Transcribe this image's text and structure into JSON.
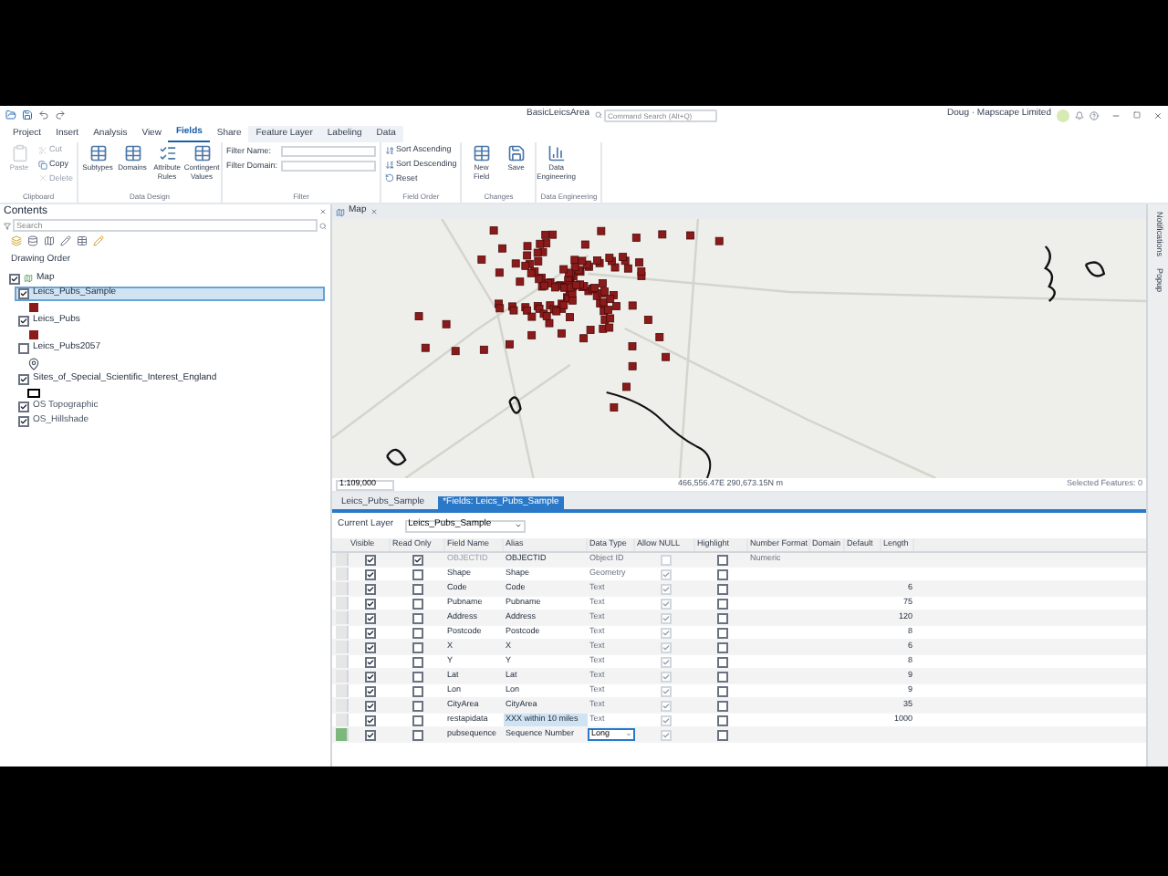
{
  "title_bar": {
    "project": "BasicLeicsArea",
    "search": {
      "placeholder": "Command Search (Alt+Q)"
    },
    "user": "Doug · Mapscape Limited"
  },
  "ribbon": {
    "tabs": [
      {
        "label": "Project",
        "selected": false,
        "contextual": false
      },
      {
        "label": "Insert",
        "selected": false,
        "contextual": false
      },
      {
        "label": "Analysis",
        "selected": false,
        "contextual": false
      },
      {
        "label": "View",
        "selected": false,
        "contextual": false
      },
      {
        "label": "Fields",
        "selected": true,
        "contextual": false
      },
      {
        "label": "Share",
        "selected": false,
        "contextual": false
      },
      {
        "label": "Feature Layer",
        "selected": false,
        "contextual": true
      },
      {
        "label": "Labeling",
        "selected": false,
        "contextual": true
      },
      {
        "label": "Data",
        "selected": false,
        "contextual": true
      }
    ],
    "groups": [
      {
        "label": "Clipboard",
        "items": [
          {
            "kind": "large",
            "label": "Paste",
            "disabled": true
          },
          {
            "kind": "small",
            "label": "Cut",
            "disabled": true
          },
          {
            "kind": "small",
            "label": "Copy",
            "disabled": false
          },
          {
            "kind": "small",
            "label": "Delete",
            "disabled": true
          }
        ]
      },
      {
        "label": "Data Design",
        "items": [
          {
            "kind": "large",
            "label": "Subtypes",
            "disabled": false
          },
          {
            "kind": "large",
            "label": "Domains",
            "disabled": false
          },
          {
            "kind": "large",
            "label": "Attribute Rules",
            "disabled": false
          },
          {
            "kind": "large",
            "label": "Contingent Values",
            "disabled": false
          }
        ]
      },
      {
        "label": "Filter",
        "items": [
          {
            "kind": "field",
            "label": "Filter Name:",
            "disabled": false
          },
          {
            "kind": "field",
            "label": "Filter Domain:",
            "disabled": false
          }
        ]
      },
      {
        "label": "Field Order",
        "items": [
          {
            "kind": "small",
            "label": "Sort Ascending",
            "disabled": false
          },
          {
            "kind": "small",
            "label": "Sort Descending",
            "disabled": false
          },
          {
            "kind": "small",
            "label": "Reset",
            "disabled": false
          }
        ]
      },
      {
        "label": "Changes",
        "items": [
          {
            "kind": "large",
            "label": "New Field",
            "disabled": false
          },
          {
            "kind": "large",
            "label": "Save",
            "disabled": false
          }
        ]
      },
      {
        "label": "Data Engineering",
        "items": [
          {
            "kind": "large",
            "label": "Data Engineering",
            "disabled": false
          }
        ]
      }
    ]
  },
  "contents": {
    "title": "Contents",
    "search": {
      "placeholder": "Search"
    },
    "heading": "Drawing Order",
    "tree": [
      {
        "label": "Map",
        "checked": true,
        "selected": false,
        "kind": "map",
        "children": [
          {
            "label": "Leics_Pubs_Sample",
            "checked": true,
            "selected": true,
            "kind": "square"
          },
          {
            "label": "Leics_Pubs",
            "checked": true,
            "selected": false,
            "kind": "square"
          },
          {
            "label": "Leics_Pubs2057",
            "checked": false,
            "selected": false,
            "kind": "marker"
          },
          {
            "label": "Sites_of_Special_Scientific_Interest_England",
            "checked": true,
            "selected": false,
            "kind": "outline"
          },
          {
            "label": "OS Topographic",
            "checked": true,
            "selected": false,
            "kind": "basemap"
          },
          {
            "label": "OS_Hillshade",
            "checked": true,
            "selected": false,
            "kind": "basemap"
          }
        ]
      }
    ]
  },
  "map": {
    "tab": "Map",
    "scale": "1:109,000",
    "coordinates": "466,556.47E 290,673.15N m",
    "selected_features": "Selected Features: 0"
  },
  "side_tabs": [
    "Notifications",
    "Popup"
  ],
  "views": [
    {
      "label": "Leics_Pubs_Sample",
      "selected": false
    },
    {
      "label": "*Fields: Leics_Pubs_Sample",
      "selected": true
    }
  ],
  "fields": {
    "current_layer_label": "Current Layer",
    "current_layer": "Leics_Pubs_Sample",
    "columns": [
      "Visible",
      "Read Only",
      "Field Name",
      "Alias",
      "Data Type",
      "Allow NULL",
      "Highlight",
      "Number Format",
      "Domain",
      "Default",
      "Length"
    ],
    "rows": [
      {
        "visible": true,
        "read_only": true,
        "field_name": "OBJECTID",
        "alias": "OBJECTID",
        "data_type": "Object ID",
        "allow_null": false,
        "highlight": false,
        "number_format": "Numeric",
        "selected": false,
        "alias_selected": false,
        "editing": false
      },
      {
        "visible": true,
        "read_only": false,
        "field_name": "Shape",
        "alias": "Shape",
        "data_type": "Geometry",
        "allow_null": true,
        "highlight": false,
        "selected": false,
        "alias_selected": false,
        "editing": false
      },
      {
        "visible": true,
        "read_only": false,
        "field_name": "Code",
        "alias": "Code",
        "data_type": "Text",
        "allow_null": true,
        "highlight": false,
        "length": "6",
        "selected": false,
        "alias_selected": false,
        "editing": false
      },
      {
        "visible": true,
        "read_only": false,
        "field_name": "Pubname",
        "alias": "Pubname",
        "data_type": "Text",
        "allow_null": true,
        "highlight": false,
        "length": "75",
        "selected": false,
        "alias_selected": false,
        "editing": false
      },
      {
        "visible": true,
        "read_only": false,
        "field_name": "Address",
        "alias": "Address",
        "data_type": "Text",
        "allow_null": true,
        "highlight": false,
        "length": "120",
        "selected": false,
        "alias_selected": false,
        "editing": false
      },
      {
        "visible": true,
        "read_only": false,
        "field_name": "Postcode",
        "alias": "Postcode",
        "data_type": "Text",
        "allow_null": true,
        "highlight": false,
        "length": "8",
        "selected": false,
        "alias_selected": false,
        "editing": false
      },
      {
        "visible": true,
        "read_only": false,
        "field_name": "X",
        "alias": "X",
        "data_type": "Text",
        "allow_null": true,
        "highlight": false,
        "length": "6",
        "selected": false,
        "alias_selected": false,
        "editing": false
      },
      {
        "visible": true,
        "read_only": false,
        "field_name": "Y",
        "alias": "Y",
        "data_type": "Text",
        "allow_null": true,
        "highlight": false,
        "length": "8",
        "selected": false,
        "alias_selected": false,
        "editing": false
      },
      {
        "visible": true,
        "read_only": false,
        "field_name": "Lat",
        "alias": "Lat",
        "data_type": "Text",
        "allow_null": true,
        "highlight": false,
        "length": "9",
        "selected": false,
        "alias_selected": false,
        "editing": false
      },
      {
        "visible": true,
        "read_only": false,
        "field_name": "Lon",
        "alias": "Lon",
        "data_type": "Text",
        "allow_null": true,
        "highlight": false,
        "length": "9",
        "selected": false,
        "alias_selected": false,
        "editing": false
      },
      {
        "visible": true,
        "read_only": false,
        "field_name": "CityArea",
        "alias": "CityArea",
        "data_type": "Text",
        "allow_null": true,
        "highlight": false,
        "length": "35",
        "selected": false,
        "alias_selected": false,
        "editing": false
      },
      {
        "visible": true,
        "read_only": false,
        "field_name": "restapidata",
        "alias": "XXX within 10 miles",
        "data_type": "Text",
        "allow_null": true,
        "highlight": false,
        "length": "1000",
        "selected": false,
        "alias_selected": true,
        "editing": false
      },
      {
        "visible": true,
        "read_only": false,
        "field_name": "pubsequence",
        "alias": "Sequence Number",
        "data_type": "Long",
        "allow_null": true,
        "highlight": false,
        "selected": true,
        "alias_selected": false,
        "editing": true
      }
    ]
  }
}
